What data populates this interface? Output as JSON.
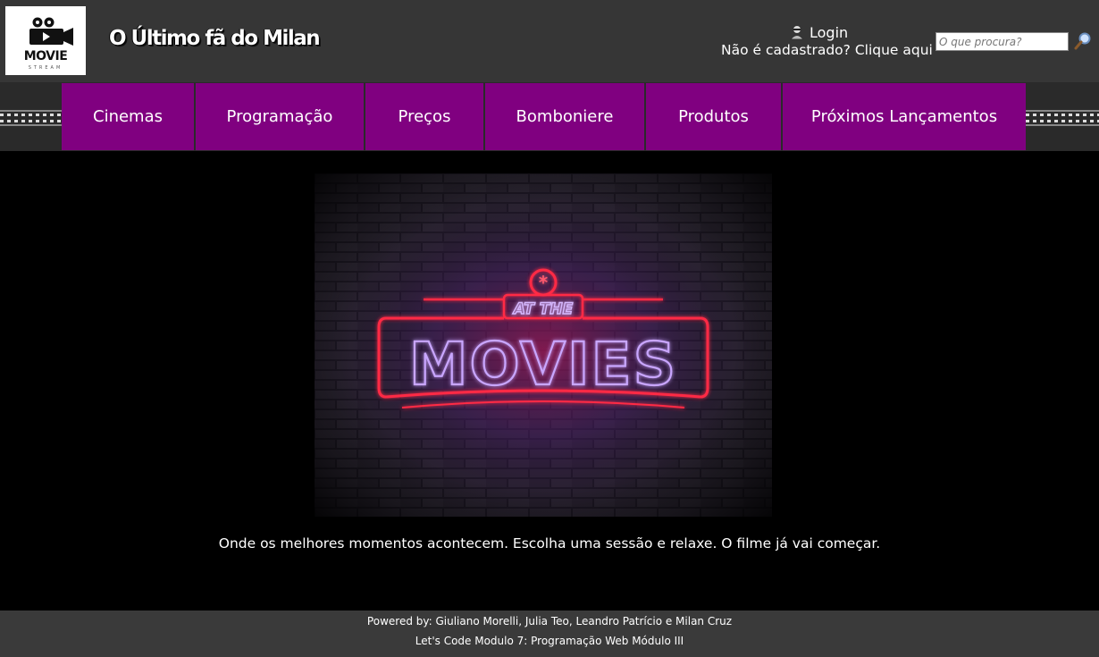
{
  "header": {
    "logo_text": "MOVIE",
    "logo_subtext": "STREAM",
    "site_title": "O Último fã do Milan",
    "login_label": "Login",
    "register_text": "Não é cadastrado? Clique aqui",
    "search_placeholder": "O que procura?"
  },
  "nav": {
    "items": [
      {
        "label": "Cinemas"
      },
      {
        "label": "Programação"
      },
      {
        "label": "Preços"
      },
      {
        "label": "Bomboniere"
      },
      {
        "label": "Produtos"
      },
      {
        "label": "Próximos Lançamentos"
      }
    ]
  },
  "hero": {
    "sign_top": "AT THE",
    "sign_main": "MOVIES",
    "tagline": "Onde os melhores momentos acontecem. Escolha uma sessão e relaxe. O filme já vai começar."
  },
  "footer": {
    "powered_by": "Powered by: Giuliano Morelli, Julia Teo, Leandro Patrício e Milan Cruz",
    "course": "Let's Code Modulo 7: Programação Web Módulo III"
  },
  "colors": {
    "header_bg": "#363636",
    "nav_bg": "#800080",
    "page_bg": "#000000",
    "footer_bg": "#3a3a3a",
    "neon_red": "#ff2a45",
    "neon_purple": "#c9a6ff"
  },
  "icons": {
    "logo": "movie-camera-icon",
    "login": "user-icon",
    "search": "magnifier-icon"
  }
}
